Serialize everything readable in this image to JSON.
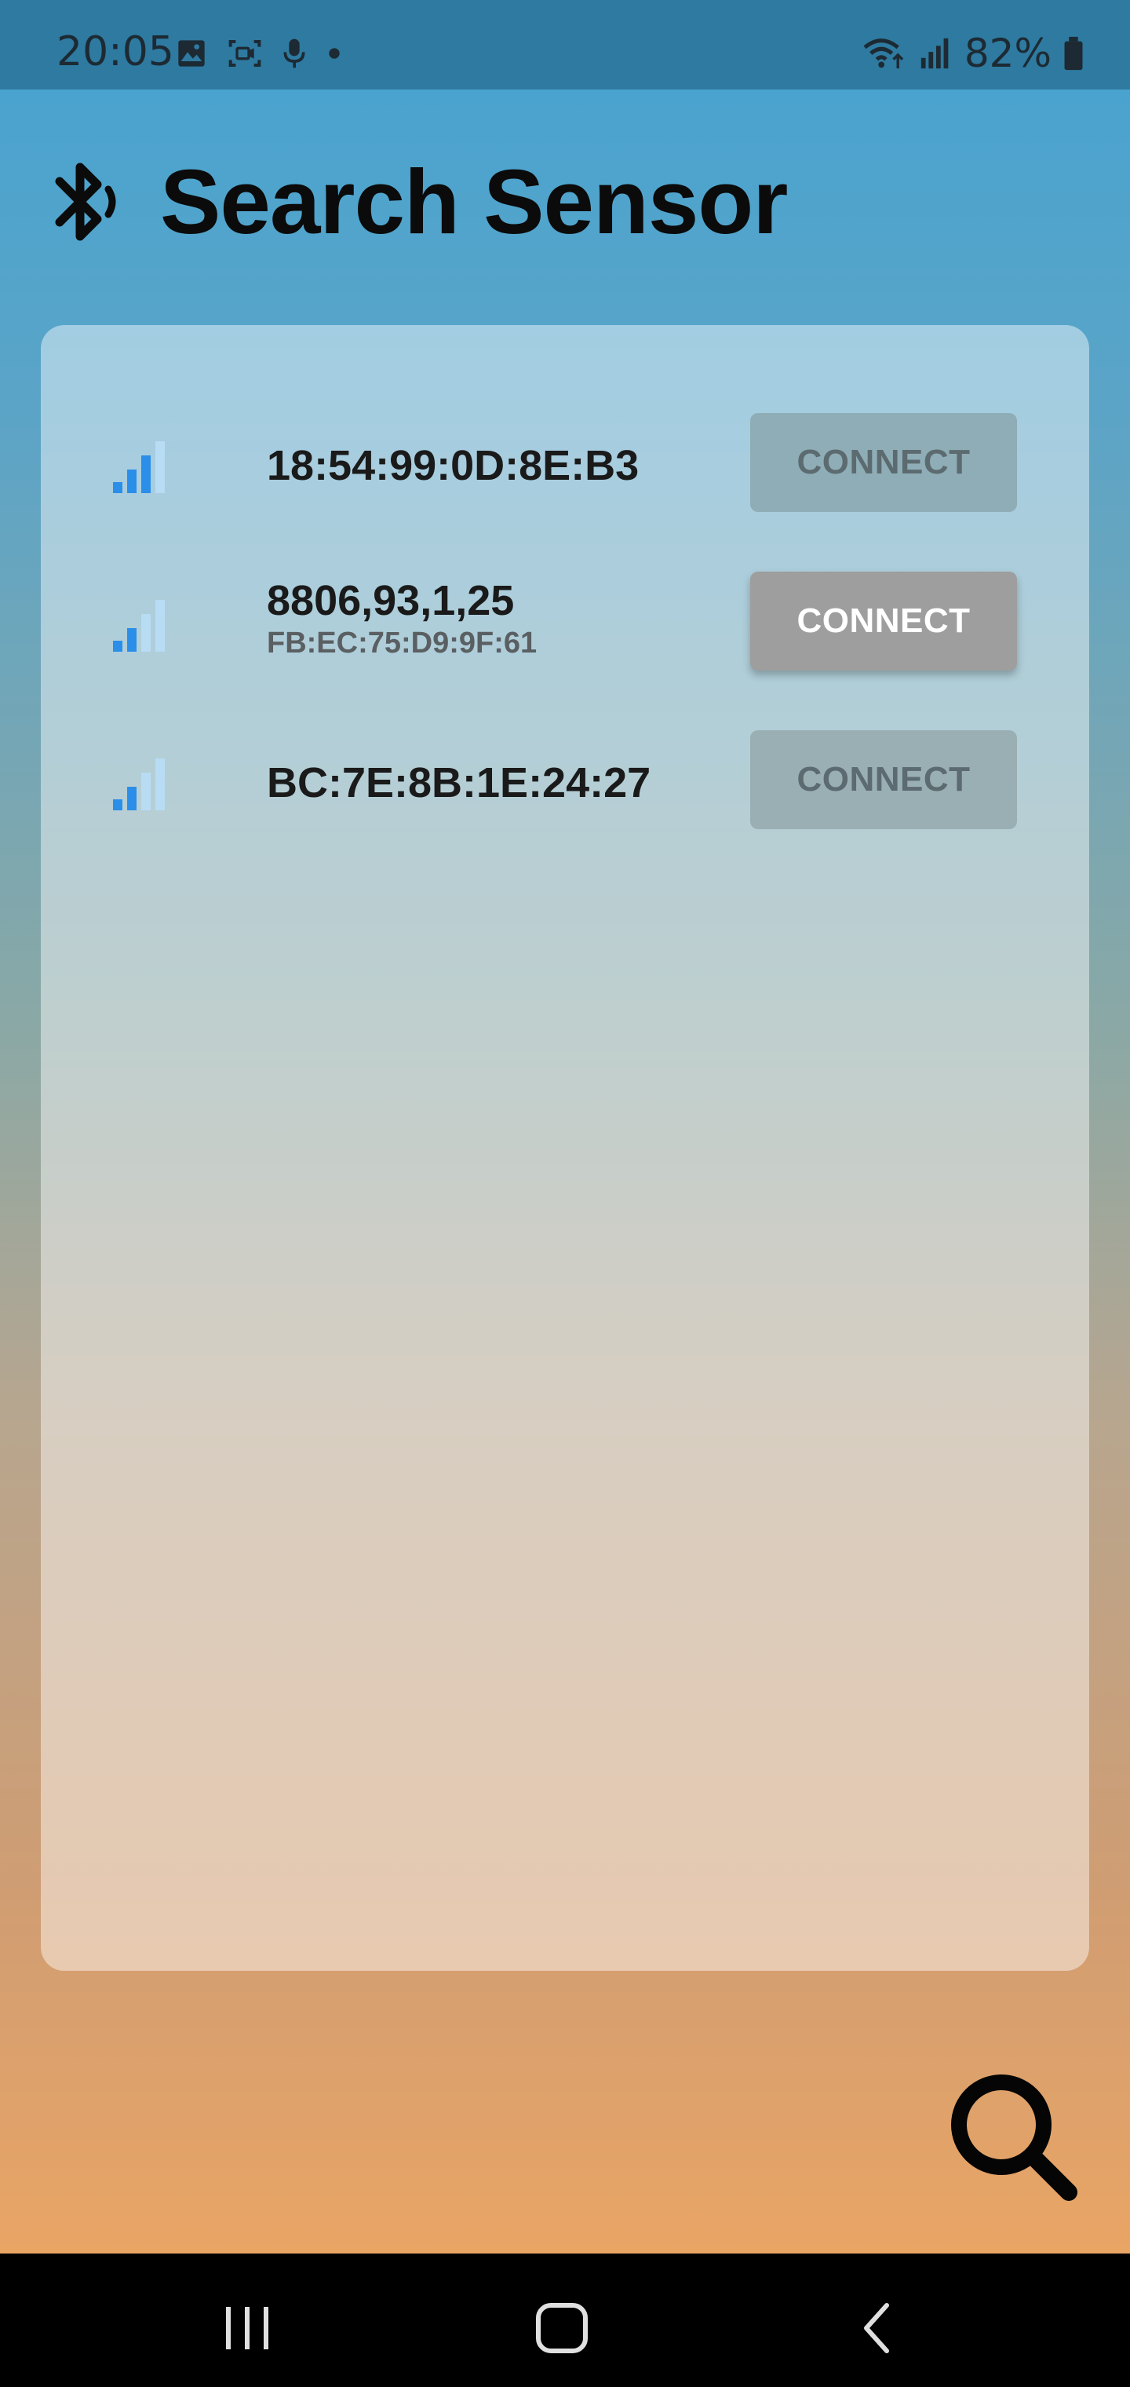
{
  "status_bar": {
    "time": "20:05",
    "battery": "82%",
    "icons": [
      "gallery-icon",
      "screen-record-icon",
      "mic-icon",
      "dot-icon",
      "wifi-icon",
      "cell-signal-icon",
      "battery-icon"
    ]
  },
  "header": {
    "title": "Search Sensor",
    "icon": "bluetooth-icon"
  },
  "devices": [
    {
      "name": "18:54:99:0D:8E:B3",
      "address": "",
      "button": "CONNECT",
      "button_state": "disabled",
      "signal_bars": 3
    },
    {
      "name": "8806,93,1,25",
      "address": "FB:EC:75:D9:9F:61",
      "button": "CONNECT",
      "button_state": "enabled",
      "signal_bars": 2
    },
    {
      "name": "BC:7E:8B:1E:24:27",
      "address": "",
      "button": "CONNECT",
      "button_state": "disabled",
      "signal_bars": 2
    }
  ],
  "fab": {
    "icon": "search-icon"
  },
  "nav": {
    "icons": [
      "recents-icon",
      "home-icon",
      "back-icon"
    ]
  },
  "colors": {
    "accent_signal": "#2b8ee8",
    "signal_inactive": "#b9dcf5",
    "status_bar": "#2e7aa0",
    "button_active": "#9e9e9e",
    "button_disabled": "#8fadb6"
  }
}
